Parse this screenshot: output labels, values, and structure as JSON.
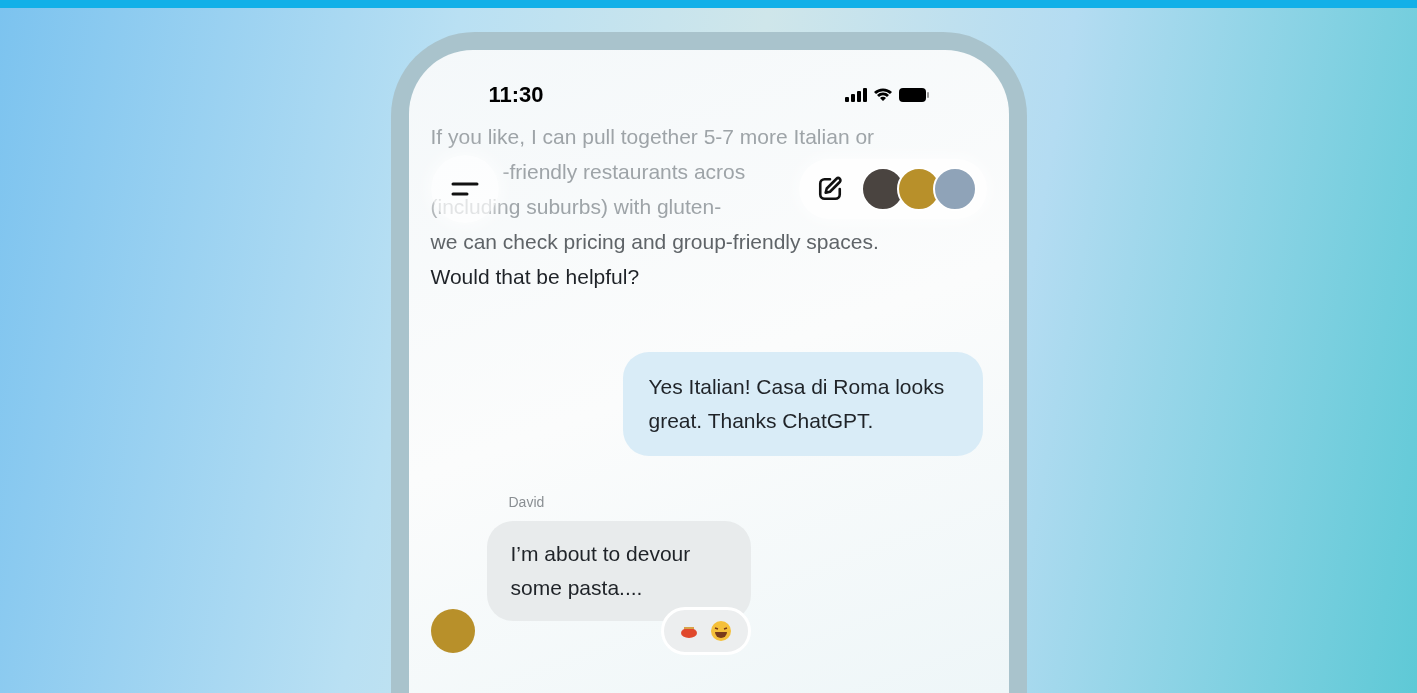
{
  "status_bar": {
    "time": "11:30"
  },
  "messages": [
    {
      "kind": "assistant",
      "lines": [
        {
          "text": "If you like, I can pull together 5-7 more Italian or",
          "faded": true,
          "starts_behind_button": false
        },
        {
          "text": "-friendly restaurants acros",
          "faded": true,
          "starts_behind_button": true
        },
        {
          "text": "(including suburbs) with gluten-",
          "faded": true,
          "starts_behind_button": false
        },
        {
          "text": "we can check pricing and group-friendly spaces.",
          "faded": false,
          "starts_behind_button": false
        },
        {
          "text": "Would that be helpful?",
          "faded": false,
          "starts_behind_button": false
        }
      ]
    },
    {
      "kind": "user",
      "text": "Yes Italian! Casa di Roma looks great. Thanks ChatGPT."
    },
    {
      "kind": "member",
      "sender": "David",
      "text": "I’m about to devour some pasta...."
    }
  ]
}
